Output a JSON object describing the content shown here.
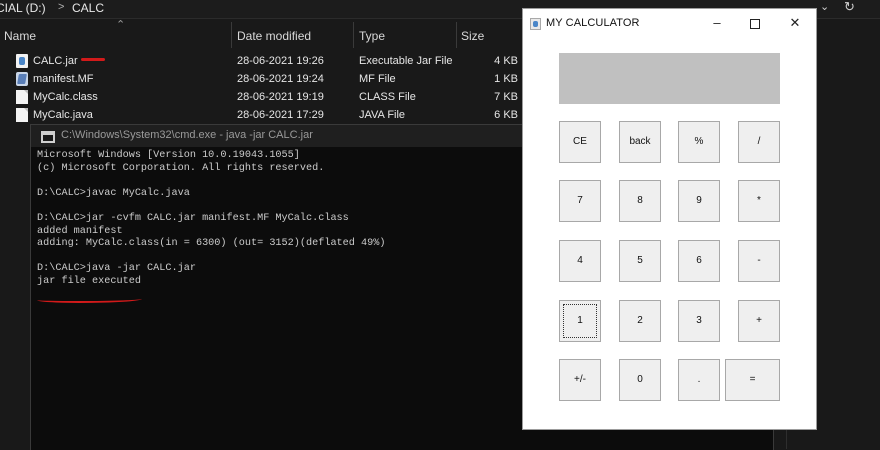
{
  "explorer": {
    "breadcrumb": {
      "drive": "CIAL (D:)",
      "separator": ">",
      "folder": "CALC"
    },
    "columns": {
      "name": "Name",
      "date": "Date modified",
      "type": "Type",
      "size": "Size"
    },
    "files": [
      {
        "name": "CALC.jar",
        "date": "28-06-2021 19:26",
        "type": "Executable Jar File",
        "size": "4 KB",
        "icon": "jar-file-icon"
      },
      {
        "name": "manifest.MF",
        "date": "28-06-2021 19:24",
        "type": "MF File",
        "size": "1 KB",
        "icon": "manifest-file-icon"
      },
      {
        "name": "MyCalc.class",
        "date": "28-06-2021 19:19",
        "type": "CLASS File",
        "size": "7 KB",
        "icon": "document-icon"
      },
      {
        "name": "MyCalc.java",
        "date": "28-06-2021 17:29",
        "type": "JAVA File",
        "size": "6 KB",
        "icon": "document-icon"
      }
    ],
    "annotation_color": "#d21a1a"
  },
  "cmd": {
    "title": "C:\\Windows\\System32\\cmd.exe - java  -jar CALC.jar",
    "lines": [
      "Microsoft Windows [Version 10.0.19043.1055]",
      "(c) Microsoft Corporation. All rights reserved.",
      "",
      "D:\\CALC>javac MyCalc.java",
      "",
      "D:\\CALC>jar -cvfm CALC.jar manifest.MF MyCalc.class",
      "added manifest",
      "adding: MyCalc.class(in = 6300) (out= 3152)(deflated 49%)",
      "",
      "D:\\CALC>java -jar CALC.jar",
      "jar file executed"
    ]
  },
  "calculator": {
    "title": "MY CALCULATOR",
    "display_value": "",
    "controls": {
      "minimize": "–",
      "close": "✕"
    },
    "buttons": {
      "ce": "CE",
      "back": "back",
      "percent": "%",
      "divide": "/",
      "seven": "7",
      "eight": "8",
      "nine": "9",
      "multiply": "*",
      "four": "4",
      "five": "5",
      "six": "6",
      "minus": "-",
      "one": "1",
      "two": "2",
      "three": "3",
      "plus": "+",
      "negate": "+/-",
      "zero": "0",
      "decimal": ".",
      "equals": "="
    },
    "display_color": "#c0c0c0"
  }
}
